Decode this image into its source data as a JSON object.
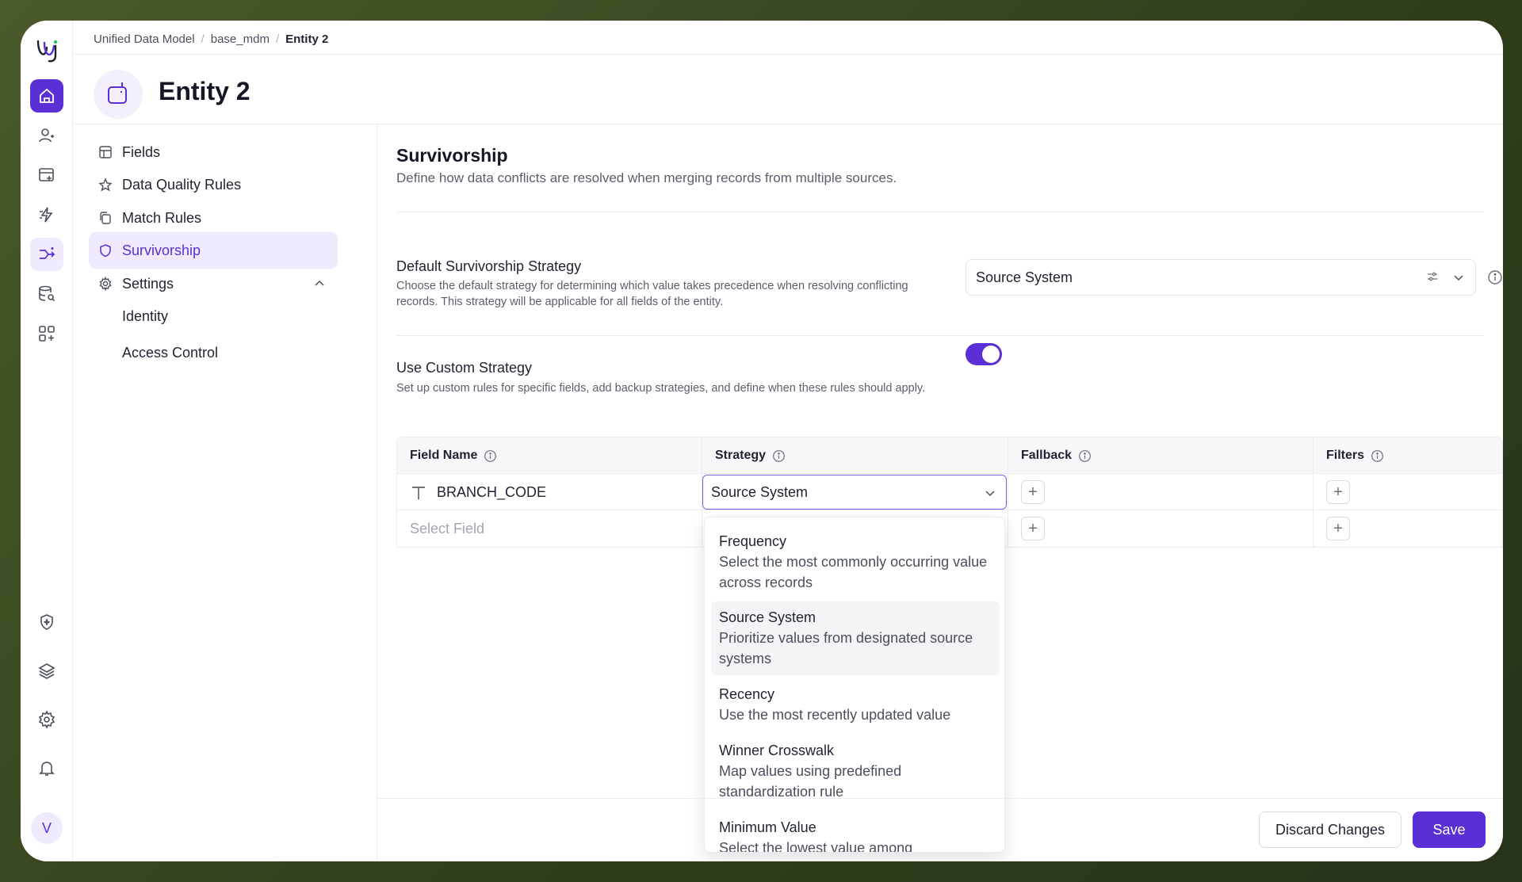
{
  "breadcrumb": {
    "items": [
      "Unified Data Model",
      "base_mdm"
    ],
    "current": "Entity 2"
  },
  "entity": {
    "title": "Entity 2"
  },
  "sidenav": {
    "items": [
      "Fields",
      "Data Quality Rules",
      "Match Rules",
      "Survivorship",
      "Settings"
    ],
    "sub_items": [
      "Identity",
      "Access Control"
    ],
    "active": "Survivorship"
  },
  "rail": {
    "avatar_initial": "V"
  },
  "section": {
    "title": "Survivorship",
    "description": "Define how data conflicts are resolved when merging records from multiple sources."
  },
  "default_strategy": {
    "title": "Default Survivorship Strategy",
    "description": "Choose the default strategy for determining which value takes precedence when resolving conflicting records. This strategy will be applicable for all fields of the entity.",
    "value": "Source System"
  },
  "custom_strategy": {
    "title": "Use Custom Strategy",
    "description": "Set up custom rules for specific fields, add backup strategies, and define when these rules should apply.",
    "enabled": true
  },
  "table": {
    "headers": [
      "Field Name",
      "Strategy",
      "Fallback",
      "Filters"
    ],
    "rows": [
      {
        "field": "BRANCH_CODE",
        "strategy": "Source System"
      }
    ],
    "placeholder_field": "Select Field"
  },
  "dropdown": {
    "options": [
      {
        "title": "Frequency",
        "desc": "Select the most commonly occurring value across records"
      },
      {
        "title": "Source System",
        "desc": "Prioritize values from designated source systems",
        "selected": true
      },
      {
        "title": "Recency",
        "desc": "Use the most recently updated value"
      },
      {
        "title": "Winner Crosswalk",
        "desc": "Map values using predefined standardization rule"
      },
      {
        "title": "Minimum Value",
        "desc": "Select the lowest value among"
      }
    ]
  },
  "footer": {
    "discard_label": "Discard Changes",
    "save_label": "Save"
  },
  "colors": {
    "accent": "#5b2fd6",
    "accent_light": "#efeafd"
  }
}
